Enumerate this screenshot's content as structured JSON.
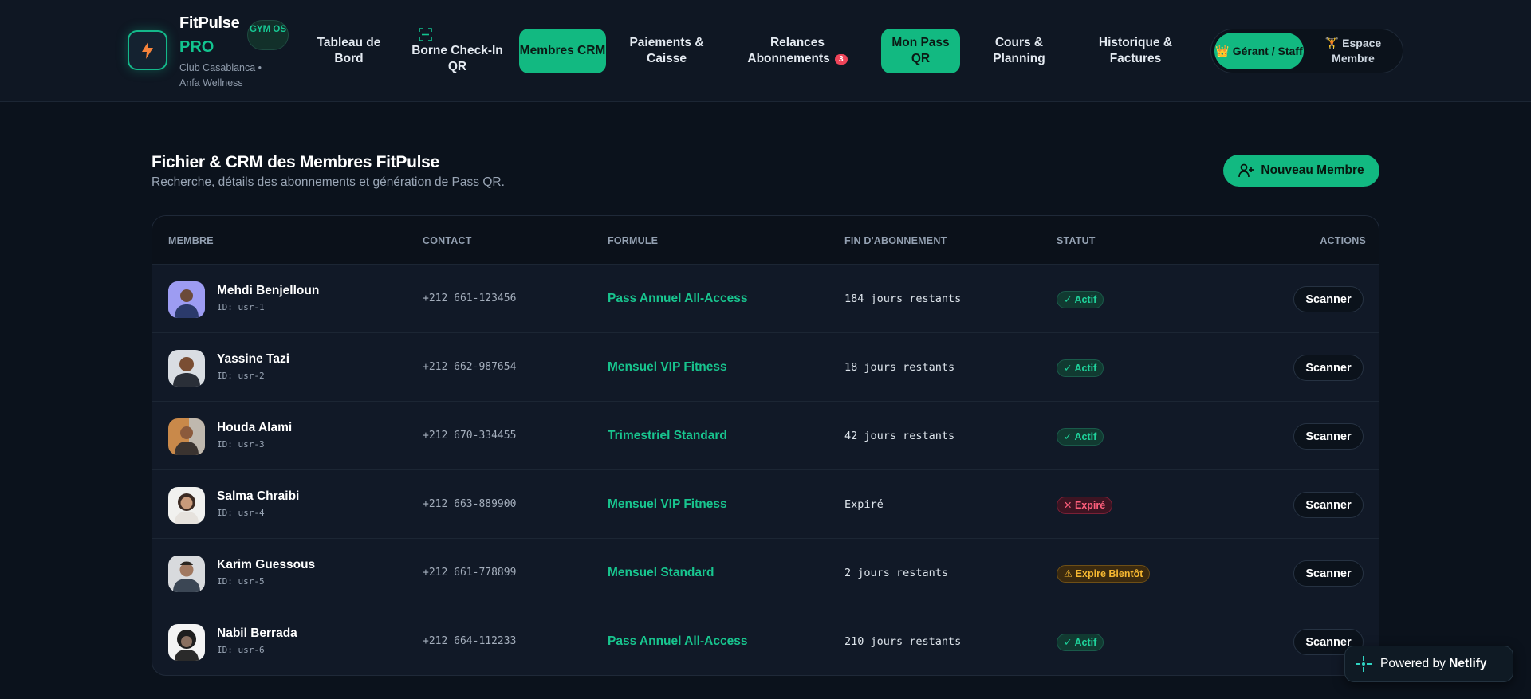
{
  "brand": {
    "name": "FitPulse",
    "tier": "PRO",
    "badge": "GYM OS",
    "club": "Club Casablanca • Anfa Wellness",
    "accent": "#12b981"
  },
  "nav": {
    "items": [
      {
        "label": "Tableau de Bord",
        "active": false
      },
      {
        "label": "Borne Check-In QR",
        "active": false,
        "icon": "qr-scan-icon"
      },
      {
        "label": "Membres CRM",
        "active": true
      },
      {
        "label": "Paiements & Caisse",
        "active": false
      },
      {
        "label": "Relances Abonnements",
        "active": false,
        "badge": "3"
      },
      {
        "label": "Mon Pass QR",
        "active": true
      },
      {
        "label": "Cours & Planning",
        "active": false
      },
      {
        "label": "Historique & Factures",
        "active": false
      }
    ],
    "roles": {
      "staff": "Gérant / Staff",
      "member": "Espace Membre",
      "staff_icon": "crown-icon",
      "member_icon": "runner-icon"
    }
  },
  "page": {
    "title": "Fichier & CRM des Membres FitPulse",
    "subtitle": "Recherche, détails des abonnements et génération de Pass QR.",
    "new_member_label": "Nouveau Membre"
  },
  "table": {
    "headers": {
      "member": "MEMBRE",
      "contact": "CONTACT",
      "plan": "FORMULE",
      "end": "FIN D'ABONNEMENT",
      "status": "STATUT",
      "actions": "ACTIONS"
    },
    "action_label": "Scanner",
    "rows": [
      {
        "name": "Mehdi Benjelloun",
        "id": "ID: usr-1",
        "contact": "+212 661-123456",
        "plan": "Pass Annuel All-Access",
        "end": "184 jours restants",
        "status": "✓ Actif",
        "status_kind": "ok"
      },
      {
        "name": "Yassine Tazi",
        "id": "ID: usr-2",
        "contact": "+212 662-987654",
        "plan": "Mensuel VIP Fitness",
        "end": "18 jours restants",
        "status": "✓ Actif",
        "status_kind": "ok"
      },
      {
        "name": "Houda Alami",
        "id": "ID: usr-3",
        "contact": "+212 670-334455",
        "plan": "Trimestriel Standard",
        "end": "42 jours restants",
        "status": "✓ Actif",
        "status_kind": "ok"
      },
      {
        "name": "Salma Chraibi",
        "id": "ID: usr-4",
        "contact": "+212 663-889900",
        "plan": "Mensuel VIP Fitness",
        "end": "Expiré",
        "status": "✕ Expiré",
        "status_kind": "bad"
      },
      {
        "name": "Karim Guessous",
        "id": "ID: usr-5",
        "contact": "+212 661-778899",
        "plan": "Mensuel Standard",
        "end": "2 jours restants",
        "status": "⚠ Expire Bientôt",
        "status_kind": "warn"
      },
      {
        "name": "Nabil Berrada",
        "id": "ID: usr-6",
        "contact": "+212 664-112233",
        "plan": "Pass Annuel All-Access",
        "end": "210 jours restants",
        "status": "✓ Actif",
        "status_kind": "ok"
      }
    ]
  },
  "footer_badge": {
    "prefix": "Powered by",
    "name": "Netlify"
  }
}
